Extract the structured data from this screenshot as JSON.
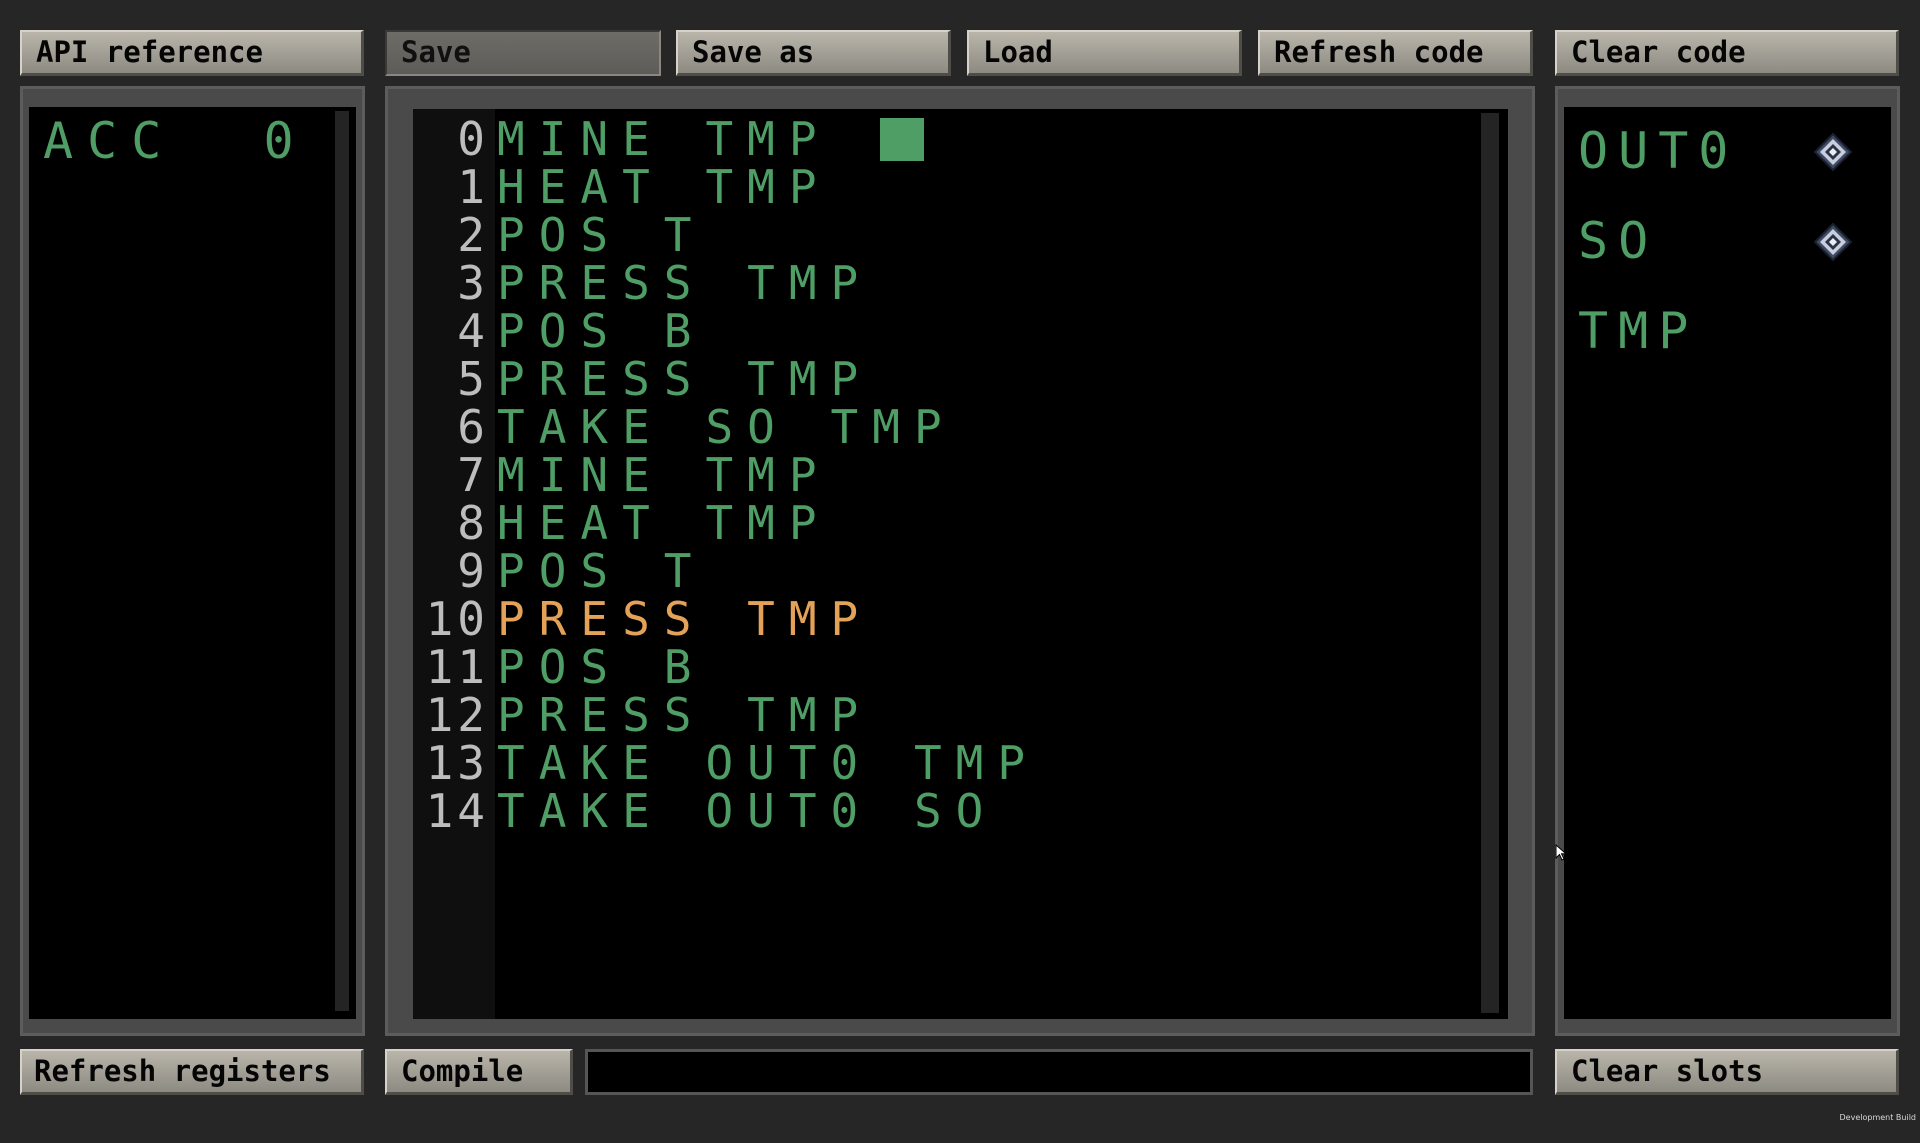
{
  "toolbar": {
    "api_reference": "API reference",
    "save": "Save",
    "save_as": "Save as",
    "load": "Load",
    "refresh_code": "Refresh code",
    "clear_code": "Clear code"
  },
  "bottom_bar": {
    "refresh_registers": "Refresh registers",
    "compile": "Compile",
    "compile_output": "",
    "clear_slots": "Clear slots"
  },
  "registers": [
    {
      "text": "ACC  0"
    }
  ],
  "editor": {
    "highlighted_line": 10,
    "lines": [
      {
        "no": "0",
        "text": "MINE TMP"
      },
      {
        "no": "1",
        "text": "HEAT TMP"
      },
      {
        "no": "2",
        "text": "POS T"
      },
      {
        "no": "3",
        "text": "PRESS TMP"
      },
      {
        "no": "4",
        "text": "POS B"
      },
      {
        "no": "5",
        "text": "PRESS TMP"
      },
      {
        "no": "6",
        "text": "TAKE SO TMP"
      },
      {
        "no": "7",
        "text": "MINE TMP"
      },
      {
        "no": "8",
        "text": "HEAT TMP"
      },
      {
        "no": "9",
        "text": "POS T"
      },
      {
        "no": "10",
        "text": "PRESS TMP"
      },
      {
        "no": "11",
        "text": "POS B"
      },
      {
        "no": "12",
        "text": "PRESS TMP"
      },
      {
        "no": "13",
        "text": "TAKE OUT0 TMP"
      },
      {
        "no": "14",
        "text": "TAKE OUT0 SO"
      }
    ]
  },
  "slots": [
    {
      "label": "OUT0",
      "icon": "diamond-ore-icon",
      "has_icon": true
    },
    {
      "label": "SO",
      "icon": "diamond-ore-icon",
      "has_icon": true
    },
    {
      "label": "TMP",
      "icon": "",
      "has_icon": false
    }
  ],
  "footer": {
    "build_label": "Development Build"
  },
  "colors": {
    "code_text": "#4e9e66",
    "highlight_line": "#e4a259",
    "line_numbers": "#bdbdbd",
    "cursor": "#4e9e66",
    "button_face": "#a8a49b",
    "background": "#262626"
  }
}
